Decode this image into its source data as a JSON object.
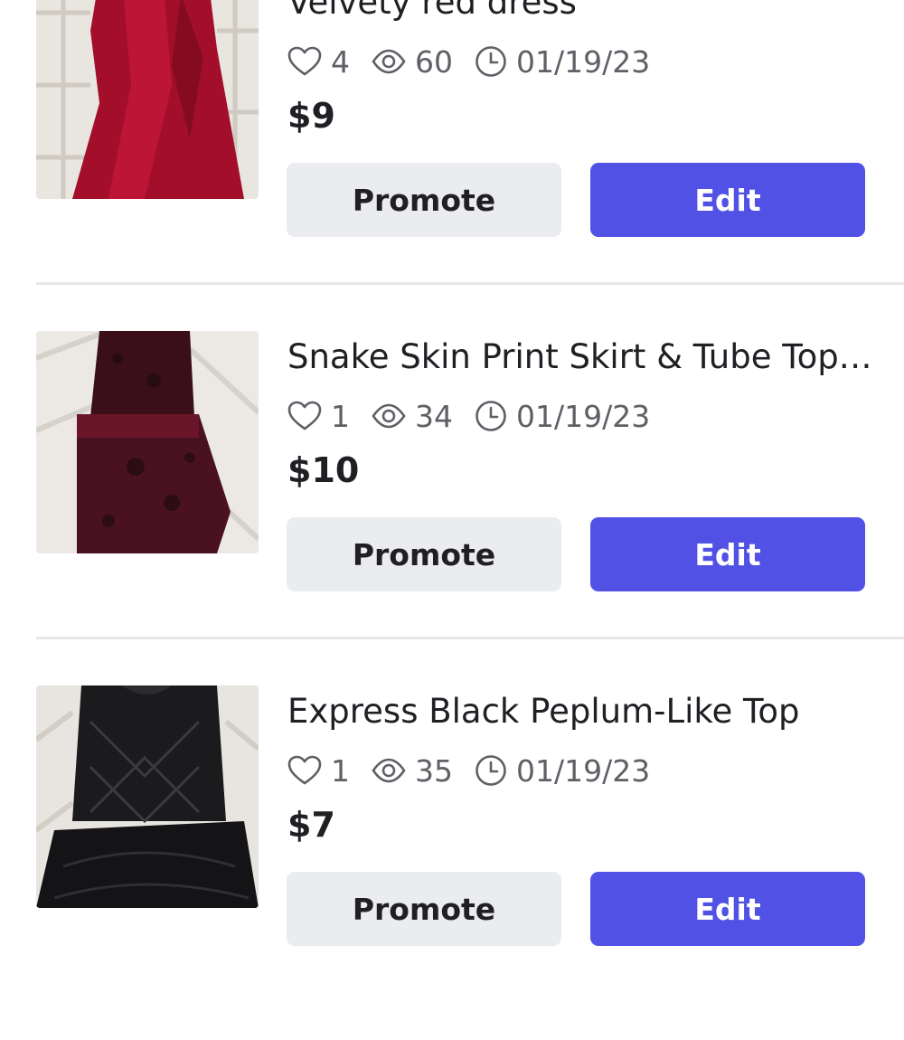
{
  "colors": {
    "primary": "#5151e6",
    "secondary_button": "#ebecf0",
    "text": "#1f1f24",
    "muted_text": "#5f5f66",
    "divider": "#e8e8eb"
  },
  "listings": [
    {
      "title": "Velvety red dress",
      "likes": "4",
      "views": "60",
      "date": "01/19/23",
      "price": "$9",
      "promote_label": "Promote",
      "edit_label": "Edit",
      "icons": [
        "heart-icon",
        "eye-icon",
        "clock-icon"
      ]
    },
    {
      "title": "Snake Skin Print Skirt & Tube Top…",
      "likes": "1",
      "views": "34",
      "date": "01/19/23",
      "price": "$10",
      "promote_label": "Promote",
      "edit_label": "Edit",
      "icons": [
        "heart-icon",
        "eye-icon",
        "clock-icon"
      ]
    },
    {
      "title": "Express Black Peplum-Like Top",
      "likes": "1",
      "views": "35",
      "date": "01/19/23",
      "price": "$7",
      "promote_label": "Promote",
      "edit_label": "Edit",
      "icons": [
        "heart-icon",
        "eye-icon",
        "clock-icon"
      ]
    }
  ]
}
